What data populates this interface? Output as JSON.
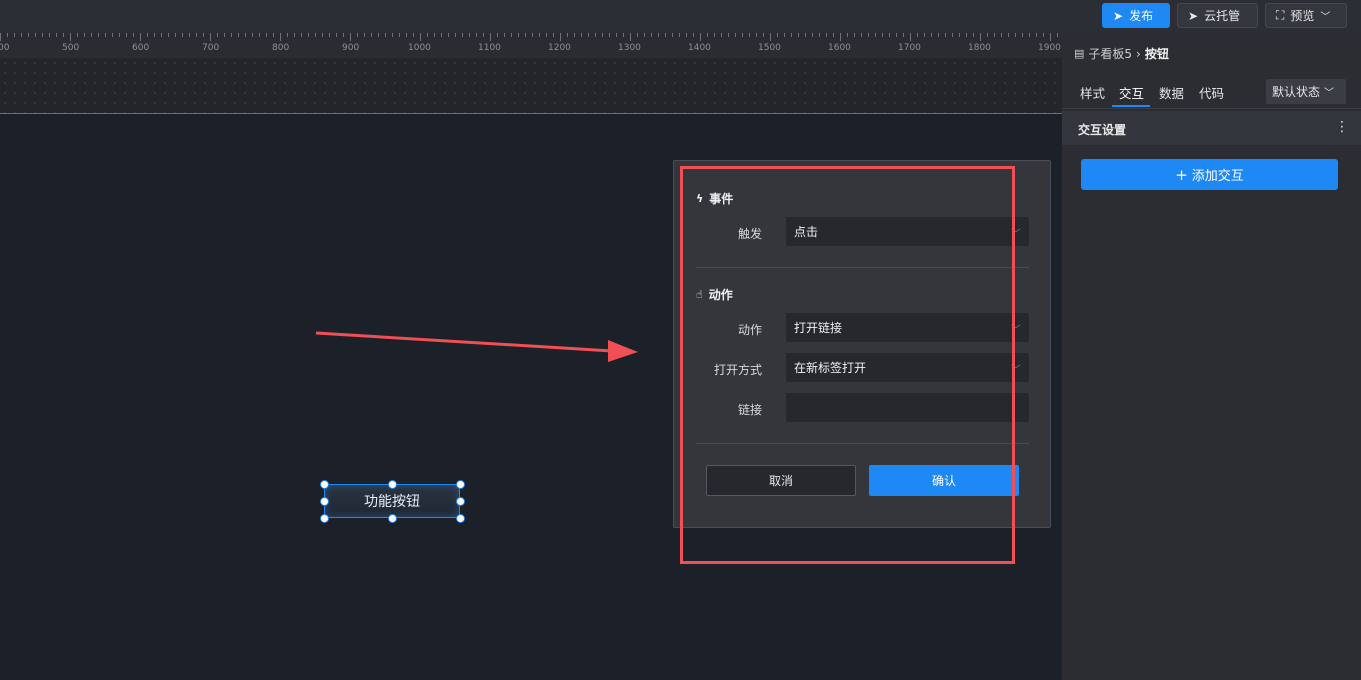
{
  "topbar": {
    "publish_label": "发布",
    "cloud_label": "云托管",
    "preview_label": "预览"
  },
  "ruler": {
    "ticks": [
      "00",
      "500",
      "600",
      "700",
      "800",
      "900",
      "1000",
      "1100",
      "1200",
      "1300",
      "1400",
      "1500",
      "1600",
      "1700",
      "1800",
      "1900"
    ]
  },
  "canvas": {
    "button_label": "功能按钮"
  },
  "dialog": {
    "event_title": "事件",
    "trigger_label": "触发",
    "trigger_value": "点击",
    "action_title": "动作",
    "action_label": "动作",
    "action_value": "打开链接",
    "open_mode_label": "打开方式",
    "open_mode_value": "在新标签打开",
    "link_label": "链接",
    "link_value": "",
    "cancel_label": "取消",
    "confirm_label": "确认"
  },
  "panel": {
    "breadcrumb_parent": "子看板5",
    "breadcrumb_current": "按钮",
    "tabs": [
      "样式",
      "交互",
      "数据",
      "代码"
    ],
    "active_tab": "交互",
    "state_select": "默认状态",
    "section_title": "交互设置",
    "add_button_label": "添加交互"
  },
  "colors": {
    "accent": "#1e88f5",
    "annotation_red": "#ef4f55"
  }
}
